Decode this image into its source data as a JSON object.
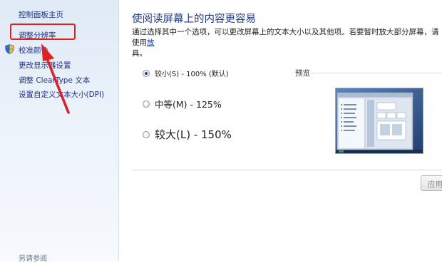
{
  "sidebar": {
    "home_link": "控制面板主页",
    "links": [
      "调整分辨率",
      "校准颜色",
      "更改显示器设置",
      "调整 ClearType 文本",
      "设置自定义文本大小(DPI)"
    ],
    "footer": "另请参阅"
  },
  "main": {
    "title": "使阅读屏幕上的内容更容易",
    "description": "通过选择其中一个选项，可以更改屏幕上的文本大小以及其他项。若要暂时放大部分屏幕，请使用",
    "description_link": "放",
    "description_end": "具。",
    "options": [
      {
        "label": "较小(S) - 100% (默认)",
        "checked": true
      },
      {
        "label": "中等(M) - 125%",
        "checked": false
      },
      {
        "label": "较大(L) - 150%",
        "checked": false
      }
    ],
    "preview_label": "预览",
    "apply_label": "应用"
  },
  "colors": {
    "link": "#1e3287",
    "title": "#1e3c8c",
    "annotation": "#e02020"
  },
  "icons": {
    "shield": "shield-icon",
    "arrow": "annotation-arrow"
  }
}
